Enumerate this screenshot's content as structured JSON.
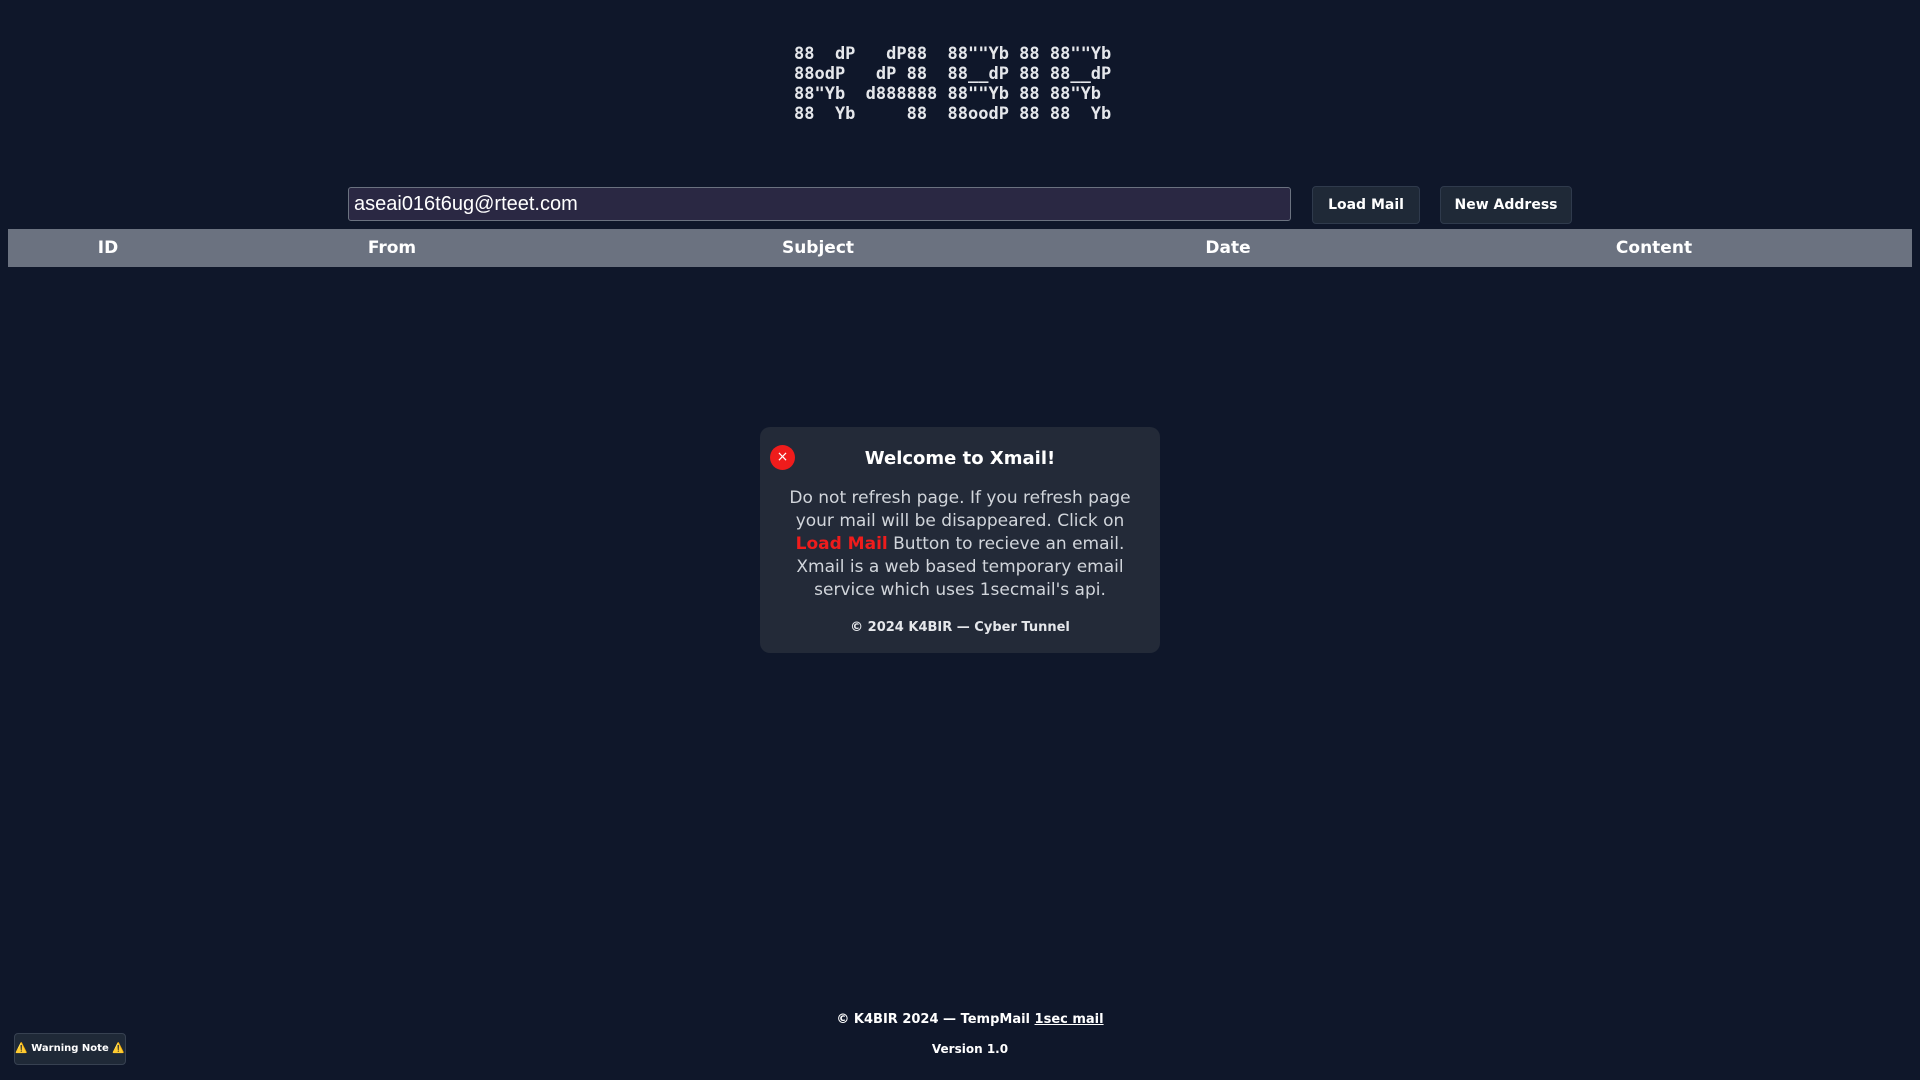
{
  "logo": {
    "ascii_art": "88  dP   dP88  88\"\"Yb 88 88\"\"Yb\n88odP   dP 88  88__dP 88 88__dP\n88\"Yb  d888888 88\"\"Yb 88 88\"Yb\n88  Yb     88  88oodP 88 88  Yb"
  },
  "controls": {
    "email_value": "aseai016t6ug@rteet.com",
    "load_label": "Load Mail",
    "new_label": "New Address"
  },
  "table": {
    "headers": [
      "ID",
      "From",
      "Subject",
      "Date",
      "Content"
    ]
  },
  "popup": {
    "close_symbol": "×",
    "title": "Welcome to Xmail!",
    "body_before": "Do not refresh page. If you refresh page your mail will be disappeared. Click on ",
    "body_highlight": "Load Mail",
    "body_after": " Button to recieve an email. Xmail is a web based temporary email service which uses 1secmail's api.",
    "footer": "© 2024 K4BIR — Cyber Tunnel"
  },
  "footer": {
    "prefix": "© K4BIR 2024 — TempMail ",
    "link_text": "1sec mail",
    "version": "Version 1.0"
  },
  "warning": {
    "label": "⚠️ Warning Note ⚠️"
  },
  "colors": {
    "background": "#0f172a",
    "table_header": "#6b7280",
    "accent_red": "#ef1c1c",
    "popup_bg": "#232a38"
  },
  "icons": {
    "popup_close": "close-icon"
  }
}
